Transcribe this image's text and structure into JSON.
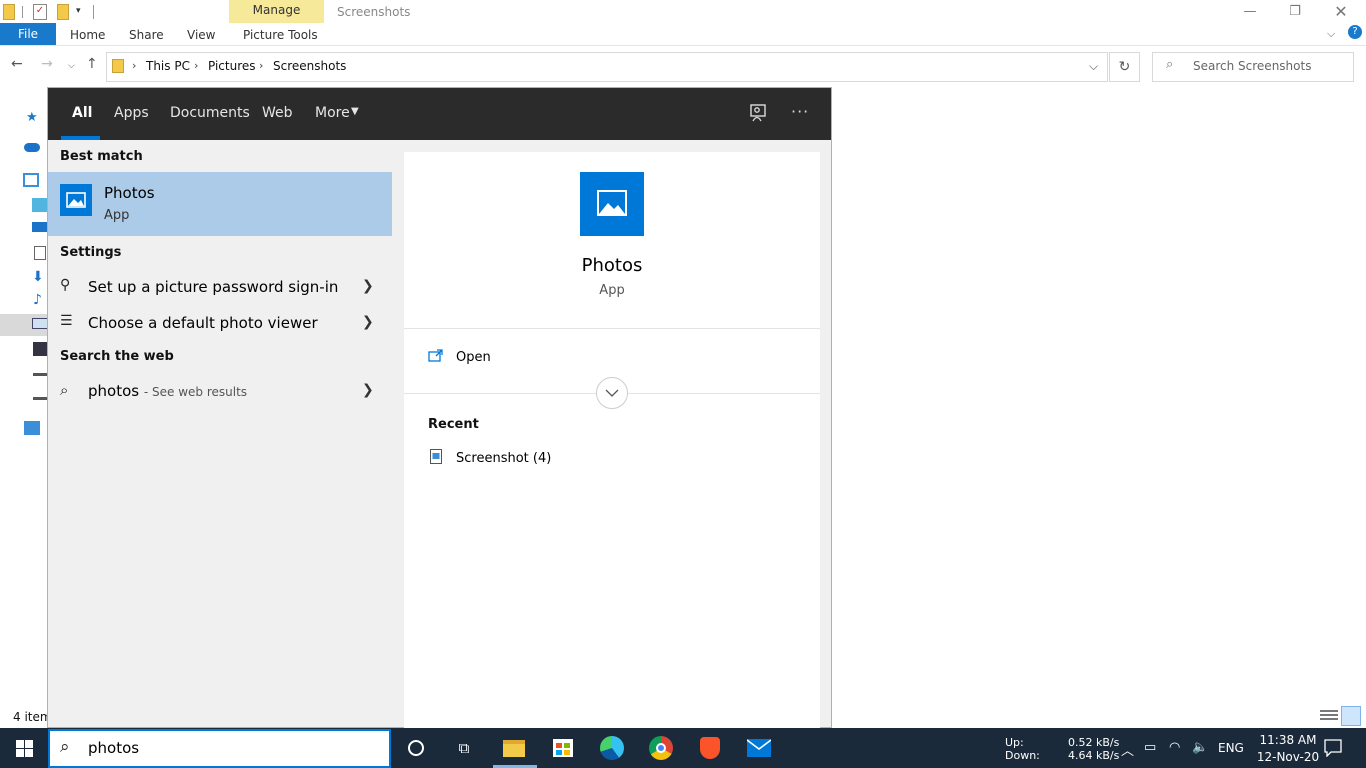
{
  "explorer": {
    "window_title": "Screenshots",
    "ribbon": {
      "file": "File",
      "home": "Home",
      "share": "Share",
      "view": "View",
      "contextual_group": "Manage",
      "contextual_tab": "Picture Tools"
    },
    "breadcrumb": [
      "This PC",
      "Pictures",
      "Screenshots"
    ],
    "search_placeholder": "Search Screenshots",
    "status": "4 item"
  },
  "search_panel": {
    "tabs": [
      "All",
      "Apps",
      "Documents",
      "Web",
      "More"
    ],
    "active_tab": "All",
    "best_match_heading": "Best match",
    "best_match": {
      "title": "Photos",
      "subtitle": "App"
    },
    "settings_heading": "Settings",
    "settings_items": [
      "Set up a picture password sign-in",
      "Choose a default photo viewer"
    ],
    "web_heading": "Search the web",
    "web_item": {
      "query": "photos",
      "suffix": "- See web results"
    },
    "preview": {
      "title": "Photos",
      "subtitle": "App",
      "open_label": "Open",
      "recent_heading": "Recent",
      "recent_items": [
        "Screenshot (4)"
      ]
    }
  },
  "taskbar": {
    "search_text": "photos",
    "net_up_label": "Up:",
    "net_down_label": "Down:",
    "net_up": "0.52 kB/s",
    "net_down": "4.64 kB/s",
    "language": "ENG",
    "time": "11:38 AM",
    "date": "12-Nov-20"
  },
  "colors": {
    "accent": "#0078d7",
    "file_tab": "#1979ca",
    "manage_tab": "#f6e99a",
    "taskbar": "#1b2a3b",
    "selected_result": "#abcbe9"
  }
}
